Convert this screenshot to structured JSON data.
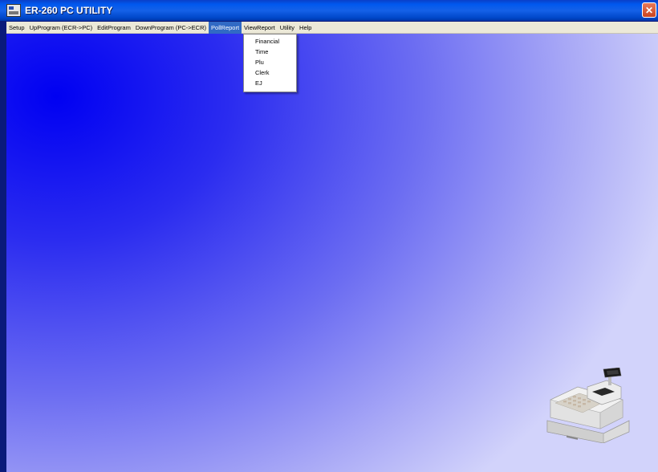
{
  "window": {
    "title": "ER-260 PC UTILITY",
    "close_glyph": "✕"
  },
  "menubar": {
    "items": [
      {
        "label": "Setup"
      },
      {
        "label": "UpProgram (ECR->PC)"
      },
      {
        "label": "EditProgram"
      },
      {
        "label": "DownProgram (PC->ECR)"
      },
      {
        "label": "PollReport"
      },
      {
        "label": "ViewReport"
      },
      {
        "label": "Utility"
      },
      {
        "label": "Help"
      }
    ],
    "active_index": 4
  },
  "dropdown": {
    "items": [
      {
        "label": "Financial"
      },
      {
        "label": "Time"
      },
      {
        "label": "Plu"
      },
      {
        "label": "Clerk"
      },
      {
        "label": "EJ"
      }
    ]
  },
  "colors": {
    "titlebar": "#0058ee",
    "menubar": "#ece9d8",
    "menu_highlight": "#316ac5",
    "background_center": "#0000f2",
    "background_edge": "#d2d3fb"
  },
  "icons": {
    "app": "app-window-icon",
    "close": "close-icon",
    "illustration": "cash-register-icon"
  }
}
